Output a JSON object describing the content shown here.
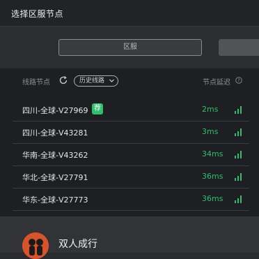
{
  "window": {
    "title": "选择区服节点"
  },
  "region": {
    "button_label": "区服"
  },
  "list_header": {
    "route_label": "线路节点",
    "history_label": "历史线路",
    "delay_label": "节点延迟"
  },
  "nodes": [
    {
      "name": "四川-全球-V27969",
      "ping": "2ms",
      "tag": "荐"
    },
    {
      "name": "四川-全球-V43281",
      "ping": "3ms"
    },
    {
      "name": "华南-全球-V43262",
      "ping": "34ms"
    },
    {
      "name": "华北-全球-V27791",
      "ping": "36ms"
    },
    {
      "name": "华东-全球-V27773",
      "ping": "36ms"
    }
  ],
  "game": {
    "name": "双人成行"
  },
  "colors": {
    "accent": "#2fbf6d",
    "background": "#1e1f22"
  },
  "icons": [
    "refresh-icon",
    "chevron-down-icon",
    "help-icon",
    "signal-icon"
  ]
}
